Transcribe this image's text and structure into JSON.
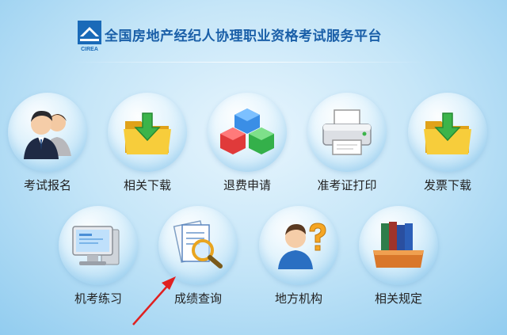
{
  "header": {
    "title": "全国房地产经纪人协理职业资格考试服务平台",
    "logo_text": "CIREA"
  },
  "tiles": [
    {
      "label": "考试报名",
      "icon": "users-icon"
    },
    {
      "label": "相关下载",
      "icon": "folder-download-icon"
    },
    {
      "label": "退费申请",
      "icon": "cubes-icon"
    },
    {
      "label": "准考证打印",
      "icon": "printer-icon"
    },
    {
      "label": "发票下载",
      "icon": "folder-download-icon"
    },
    {
      "label": "机考练习",
      "icon": "computer-icon"
    },
    {
      "label": "成绩查询",
      "icon": "document-search-icon"
    },
    {
      "label": "地方机构",
      "icon": "person-question-icon"
    },
    {
      "label": "相关规定",
      "icon": "books-icon"
    }
  ],
  "colors": {
    "title": "#1a5fa8",
    "annotation_arrow": "#e02020"
  }
}
